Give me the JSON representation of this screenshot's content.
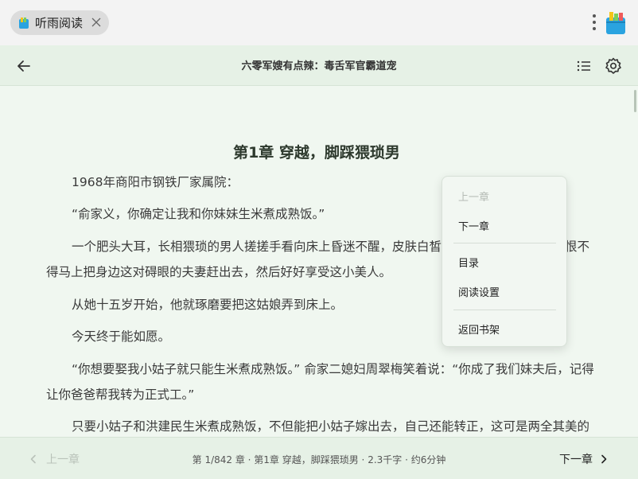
{
  "tab": {
    "title": "听雨阅读",
    "icons": {
      "app": "book-icon",
      "close": "close-icon"
    }
  },
  "window": {
    "menu_icon": "vertical-dots-icon",
    "app_icon": "app-book-icon"
  },
  "reader": {
    "book_title": "六零军嫂有点辣：毒舌军官霸道宠",
    "icons": {
      "back": "arrow-left-icon",
      "toc": "list-icon",
      "settings": "gear-icon"
    }
  },
  "chapter": {
    "title": "第1章 穿越，脚踩猥琐男",
    "paragraphs": [
      "1968年商阳市钢铁厂家属院：",
      "“俞家义，你确定让我和你妹妹生米煮成熟饭。”",
      "一个肥头大耳，长相猥琐的男人搓搓手看向床上昏迷不醒，皮肤白皙的姑娘，他舔了舔唇，恨不得马上把身边这对碍眼的夫妻赶出去，然后好好享受这小美人。",
      "从她十五岁开始，他就琢磨要把这姑娘弄到床上。",
      "今天终于能如愿。",
      "“你想要娶我小姑子就只能生米煮成熟饭。” 俞家二媳妇周翠梅笑着说：“你成了我们妹夫后，记得让你爸爸帮我转为正式工。”",
      "只要小姑子和洪建民生米煮成熟饭，不但能把小姑子嫁出去，自己还能转正，这可是两全其美的好事。"
    ]
  },
  "context_menu": {
    "items": [
      "上一章",
      "下一章",
      "目录",
      "阅读设置",
      "返回书架"
    ],
    "disabled": [
      "上一章"
    ]
  },
  "bottom_bar": {
    "prev_label": "上一章",
    "next_label": "下一章",
    "progress": "第 1/842 章 · 第1章 穿越，脚踩猥琐男 · 2.3千字 · 约6分钟"
  },
  "colors": {
    "reader_bg": "#f0f7f0",
    "bar_bg": "#e6f1e6",
    "chapter_title": "#2e3a2e",
    "disabled_text": "#b5bbb5"
  }
}
